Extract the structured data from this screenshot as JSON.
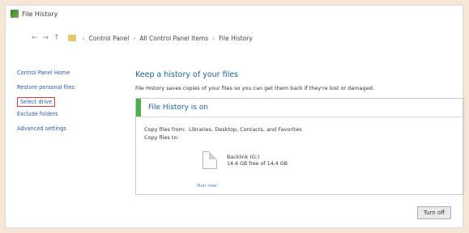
{
  "window": {
    "title": "File History",
    "icon": "file-history-icon"
  },
  "address": {
    "crumbs": [
      "Control Panel",
      "All Control Panel Items",
      "File History"
    ]
  },
  "sidebar": {
    "items": [
      {
        "label": "Control Panel Home"
      },
      {
        "label": "Restore personal files"
      },
      {
        "label": "Select drive",
        "selected": true
      },
      {
        "label": "Exclude folders"
      },
      {
        "label": "Advanced settings"
      }
    ]
  },
  "main": {
    "heading": "Keep a history of your files",
    "description": "File History saves copies of your files so you can get them back if they're lost or damaged.",
    "status": {
      "text": "File History is on",
      "accent": "#4caf50"
    },
    "copy_from_label": "Copy files from:",
    "copy_from_value": "Libraries, Desktop, Contacts, and Favorites",
    "copy_to_label": "Copy files to:",
    "drive_name": "Backlink (G:)",
    "drive_space": "14.4 GB free of 14.4 GB",
    "run_now_label": "Run now",
    "turn_off_label": "Turn off"
  }
}
